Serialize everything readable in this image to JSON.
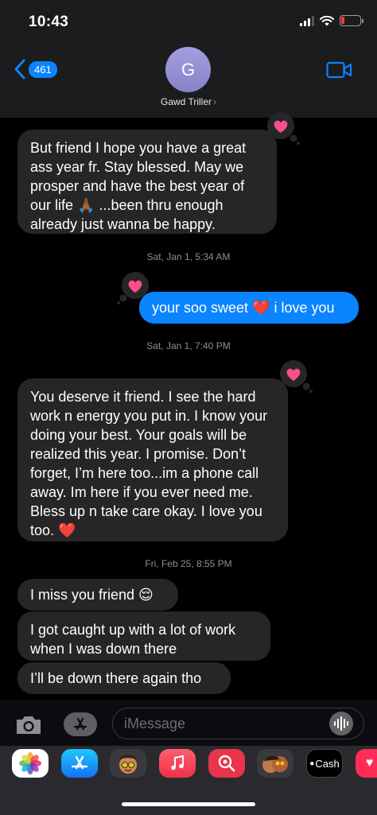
{
  "status": {
    "time": "10:43"
  },
  "header": {
    "back_count": "461",
    "avatar_initial": "G",
    "contact_name": "Gawd Triller"
  },
  "messages": {
    "m1": "But friend I hope you have a great ass year fr. Stay blessed. May we prosper and have the best year of our life 🙏🏾 ...been thru enough already just wanna be happy.",
    "ts1": "Sat, Jan 1, 5:34 AM",
    "m2": "your soo sweet ❤️ i love you",
    "ts2": "Sat, Jan 1, 7:40 PM",
    "m3": "You deserve it friend. I see the hard work n energy you put in. I know your doing your best. Your goals will be realized this year. I promise. Don’t forget, I’m here too...im a phone call away. Im here if you ever need me. Bless up n take care okay. I love you too. ❤️",
    "ts3": "Fri, Feb 25, 8:55 PM",
    "m4": "I miss you friend 😌",
    "m5": "I got caught up with a lot of work when I was down there",
    "m6": "I’ll be down there again tho"
  },
  "input": {
    "placeholder": "iMessage"
  },
  "apps": {
    "cash_label": "Cash"
  },
  "colors": {
    "accent": "#0a84ff",
    "bubble_in": "#262629",
    "tapback_heart": "#ff4f8b"
  }
}
